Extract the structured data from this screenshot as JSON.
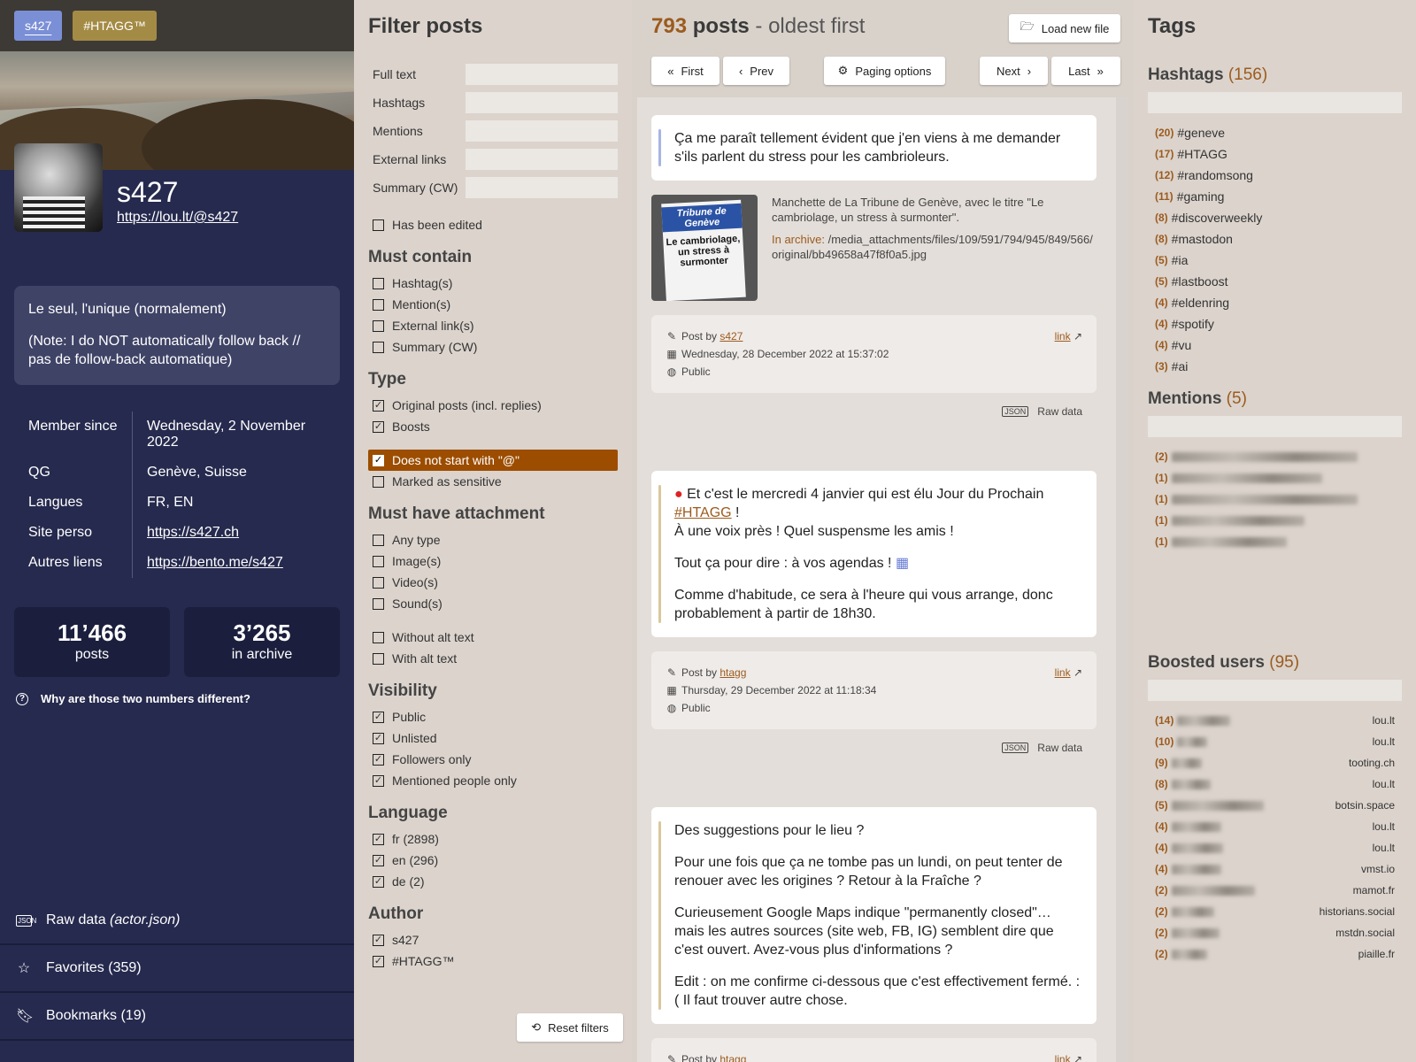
{
  "accounts": {
    "s427": "s427",
    "htagg": "#HTAGG™"
  },
  "profile": {
    "name": "s427",
    "url": "https://lou.lt/@s427",
    "bio": [
      "Le seul, l'unique (normalement)",
      "(Note: I do NOT automatically follow back // pas de follow-back automatique)"
    ],
    "fields": [
      {
        "k": "Member since",
        "v": "Wednesday, 2 November 2022"
      },
      {
        "k": "QG",
        "v": "Genève, Suisse"
      },
      {
        "k": "Langues",
        "v": "FR, EN"
      },
      {
        "k": "Site perso",
        "v": "https://s427.ch"
      },
      {
        "k": "Autres liens",
        "v": "https://bento.me/s427"
      }
    ],
    "posts_count": "11’466",
    "posts_label": "posts",
    "archive_count": "3’265",
    "archive_label": "in archive",
    "why": "Why are those two numbers different?"
  },
  "sidenav": {
    "raw_label": "Raw data",
    "raw_file": "(actor.json)",
    "favorites": "Favorites (359)",
    "bookmarks": "Bookmarks (19)"
  },
  "filter": {
    "title": "Filter posts",
    "text_fields": [
      "Full text",
      "Hashtags",
      "Mentions",
      "External links",
      "Summary (CW)"
    ],
    "edited": "Has been edited",
    "must_contain_title": "Must contain",
    "must_contain": [
      "Hashtag(s)",
      "Mention(s)",
      "External link(s)",
      "Summary (CW)"
    ],
    "type_title": "Type",
    "type_a": [
      "Original posts (incl. replies)",
      "Boosts"
    ],
    "type_b": [
      "Does not start with \"@\"",
      "Marked as sensitive"
    ],
    "attach_title": "Must have attachment",
    "attach_a": [
      "Any type",
      "Image(s)",
      "Video(s)",
      "Sound(s)"
    ],
    "attach_b": [
      "Without alt text",
      "With alt text"
    ],
    "vis_title": "Visibility",
    "vis": [
      "Public",
      "Unlisted",
      "Followers only",
      "Mentioned people only"
    ],
    "lang_title": "Language",
    "lang": [
      "fr (2898)",
      "en (296)",
      "de (2)"
    ],
    "author_title": "Author",
    "author": [
      "s427",
      "#HTAGG™"
    ],
    "reset": "Reset filters"
  },
  "main": {
    "count": "793",
    "posts_word": "posts",
    "order": " - oldest first",
    "load": "Load new file",
    "first": "First",
    "prev": "Prev",
    "paging": "Paging options",
    "next": "Next",
    "last": "Last",
    "post_by": "Post by",
    "link": "link",
    "raw": "Raw data",
    "posts": [
      {
        "paras": [
          "Ça me paraît tellement évident que j'en viens à me demander s'ils parlent du stress pour les cambrioleurs."
        ],
        "att_desc": "Manchette de La Tribune de Genève, avec le titre \"Le cambriolage, un stress à surmonter\".",
        "att_label": "In archive:",
        "att_path": "/media_attachments/files/109/591/794/945/849/566/original/bb49658a47f8f0a5.jpg",
        "thumb_head": "Tribune de Genève",
        "thumb_body": "Le cambriolage, un stress à surmonter",
        "author": "s427",
        "date": "Wednesday, 28 December 2022 at 15:37:02",
        "vis": "Public"
      },
      {
        "p1a": "Et c'est le mercredi 4 janvier qui est élu Jour du Prochain ",
        "p1tag": "#HTAGG",
        "p1b": " !",
        "p1c": "À une voix près ! Quel suspensme les amis !",
        "p2": "Tout ça pour dire : à vos agendas !",
        "p3": "Comme d'habitude, ce sera à l'heure qui vous arrange, donc probablement à partir de 18h30.",
        "author": "htagg",
        "date": "Thursday, 29 December 2022 at 11:18:34",
        "vis": "Public"
      },
      {
        "paras": [
          "Des suggestions pour le lieu ?",
          "Pour une fois que ça ne tombe pas un lundi, on peut tenter de renouer avec les origines ? Retour à la Fraîche ?",
          "Curieusement Google Maps indique \"permanently closed\"… mais les autres sources (site web, FB, IG) semblent dire que c'est ouvert. Avez-vous plus d'informations ?",
          "Edit : on me confirme ci-dessous que c'est effectivement fermé. :( Il faut trouver autre chose."
        ],
        "author": "htagg"
      }
    ]
  },
  "tags": {
    "title": "Tags",
    "hashtags_title": "Hashtags",
    "hashtags_count": "(156)",
    "hashtags": [
      {
        "c": "(20)",
        "t": "#geneve"
      },
      {
        "c": "(17)",
        "t": "#HTAGG"
      },
      {
        "c": "(12)",
        "t": "#randomsong"
      },
      {
        "c": "(11)",
        "t": "#gaming"
      },
      {
        "c": "(8)",
        "t": "#discoverweekly"
      },
      {
        "c": "(8)",
        "t": "#mastodon"
      },
      {
        "c": "(5)",
        "t": "#ia"
      },
      {
        "c": "(5)",
        "t": "#lastboost"
      },
      {
        "c": "(4)",
        "t": "#eldenring"
      },
      {
        "c": "(4)",
        "t": "#spotify"
      },
      {
        "c": "(4)",
        "t": "#vu"
      },
      {
        "c": "(3)",
        "t": "#ai"
      }
    ],
    "mentions_title": "Mentions",
    "mentions_count": "(5)",
    "mentions": [
      "(2)",
      "(1)",
      "(1)",
      "(1)",
      "(1)"
    ],
    "boosted_title": "Boosted users",
    "boosted_count": "(95)",
    "boosted": [
      {
        "c": "(14)",
        "s": "lou.lt"
      },
      {
        "c": "(10)",
        "s": "lou.lt"
      },
      {
        "c": "(9)",
        "s": "tooting.ch"
      },
      {
        "c": "(8)",
        "s": "lou.lt"
      },
      {
        "c": "(5)",
        "s": "botsin.space"
      },
      {
        "c": "(4)",
        "s": "lou.lt"
      },
      {
        "c": "(4)",
        "s": "lou.lt"
      },
      {
        "c": "(4)",
        "s": "vmst.io"
      },
      {
        "c": "(2)",
        "s": "mamot.fr"
      },
      {
        "c": "(2)",
        "s": "historians.social"
      },
      {
        "c": "(2)",
        "s": "mstdn.social"
      },
      {
        "c": "(2)",
        "s": "piaille.fr"
      }
    ]
  }
}
